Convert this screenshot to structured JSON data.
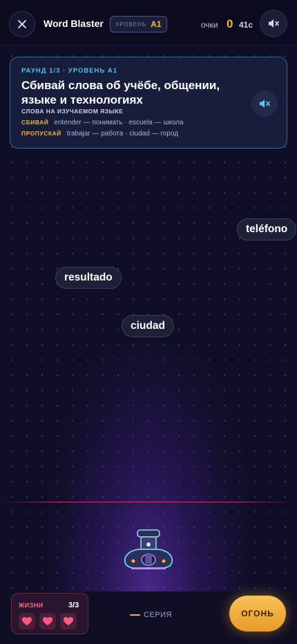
{
  "header": {
    "title": "Word Blaster",
    "level_label": "УРОВЕНЬ",
    "level_value": "A1",
    "score_label": "очки",
    "score_value": "0",
    "timer": "41с",
    "close_icon": "close-icon",
    "mute_icon": "speaker-muted-icon"
  },
  "card": {
    "round": "РАУНД 1/3 · УРОВЕНЬ A1",
    "task": "Сбивай слова об учёбе, общении, языке и технологиях",
    "subtitle": "СЛОВА НА ИЗУЧАЕМОМ ЯЗЫКЕ",
    "shoot_tag": "СБИВАЙ",
    "shoot_examples": "entender — понимать · escuela — школа",
    "skip_tag": "ПРОПУСКАЙ",
    "skip_examples": "trabajar — работа · ciudad — город",
    "audio_icon": "speaker-muted-icon"
  },
  "words": [
    "teléfono",
    "resultado",
    "ciudad"
  ],
  "bottom": {
    "lives_label": "ЖИЗНИ",
    "lives_count": "3/3",
    "lives_current": 3,
    "lives_max": 3,
    "streak_label": "СЕРИЯ",
    "fire_label": "ОГОНЬ"
  },
  "colors": {
    "accent_gold": "#f5b534",
    "accent_cyan": "#53c2ee",
    "heart_pink": "#ff5a86",
    "background": "#100e26"
  }
}
